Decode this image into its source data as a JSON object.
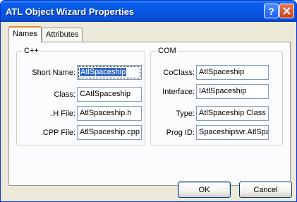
{
  "window": {
    "title": "ATL Object Wizard Properties"
  },
  "titlebar_buttons": {
    "help": "?",
    "close": "×"
  },
  "tabs": [
    {
      "label": "Names",
      "active": true
    },
    {
      "label": "Attributes",
      "active": false
    }
  ],
  "cpp_group": {
    "title": "C++",
    "short_name_label": "Short Name:",
    "short_name_value": "AtlSpaceship",
    "class_label": "Class:",
    "class_value": "CAtlSpaceship",
    "h_file_label": ".H File:",
    "h_file_value": "AtlSpaceship.h",
    "cpp_file_label": ".CPP File:",
    "cpp_file_value": "AtlSpaceship.cpp"
  },
  "com_group": {
    "title": "COM",
    "coclass_label": "CoClass:",
    "coclass_value": "AtlSpaceship",
    "interface_label": "Interface:",
    "interface_value": "IAtlSpaceship",
    "type_label": "Type:",
    "type_value": "AtlSpaceship Class",
    "progid_label": "Prog ID:",
    "progid_value": "Spaceshipsvr.AtlSpa"
  },
  "buttons": {
    "ok": "OK",
    "cancel": "Cancel"
  },
  "colors": {
    "titlebar": "#0556e0",
    "face": "#ece9d8",
    "selection": "#316ac5"
  }
}
